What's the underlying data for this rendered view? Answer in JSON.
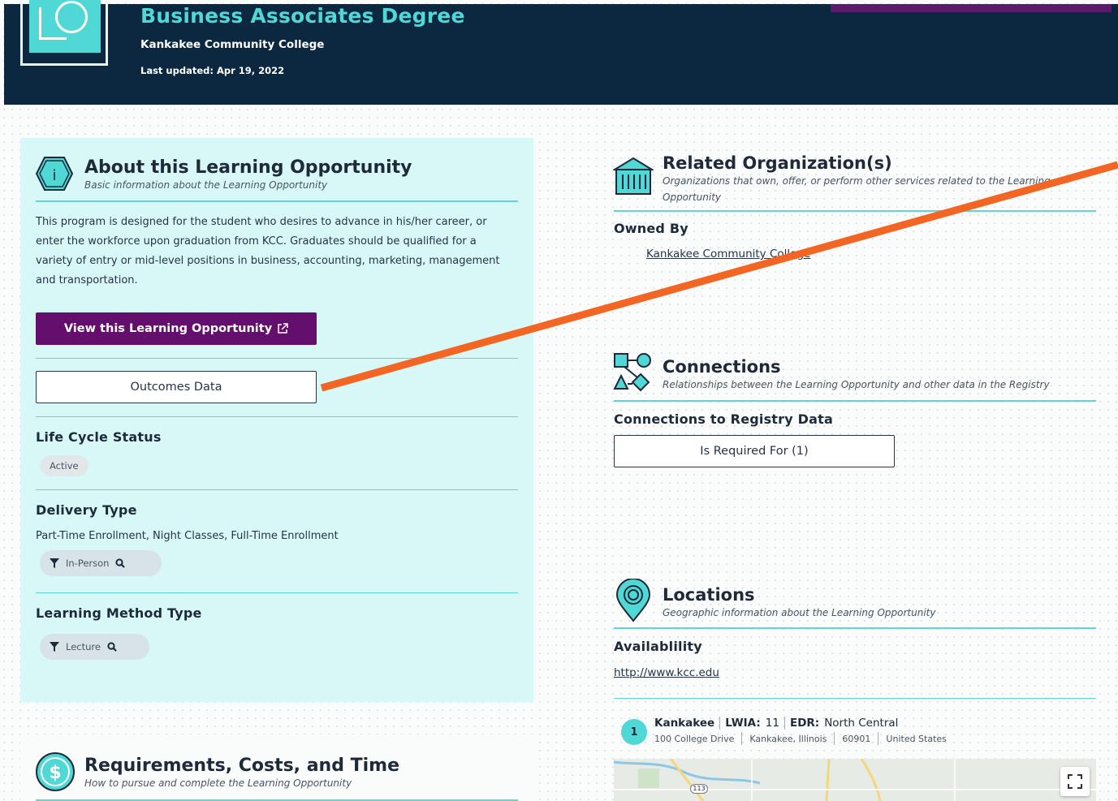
{
  "header": {
    "title": "Business Associates Degree",
    "organization": "Kankakee Community College",
    "last_updated": "Last updated: Apr 19, 2022"
  },
  "about": {
    "title": "About this Learning Opportunity",
    "subtitle": "Basic information about the Learning Opportunity",
    "description": "This program is designed for the student who desires to advance in his/her career, or enter the workforce upon graduation from KCC. Graduates should be qualified for a variety of entry or mid-level positions in business, accounting, marketing, management and transportation.",
    "view_button": "View this Learning Opportunity",
    "outcomes_button": "Outcomes Data",
    "life_cycle_label": "Life Cycle Status",
    "life_cycle_value": "Active",
    "delivery_label": "Delivery Type",
    "delivery_text": "Part-Time Enrollment, Night Classes, Full-Time Enrollment",
    "delivery_tag": "In-Person",
    "learning_method_label": "Learning Method Type",
    "learning_method_tag": "Lecture"
  },
  "requirements": {
    "title": "Requirements, Costs, and Time",
    "subtitle": "How to pursue and complete the Learning Opportunity"
  },
  "related_orgs": {
    "title": "Related Organization(s)",
    "subtitle": "Organizations that own, offer, or perform other services related to the Learning Opportunity",
    "owned_by_label": "Owned By",
    "owner": "Kankakee Community College"
  },
  "connections": {
    "title": "Connections",
    "subtitle": "Relationships between the Learning Opportunity and other data in the Registry",
    "label": "Connections to Registry Data",
    "button": "Is Required For (1)"
  },
  "locations": {
    "title": "Locations",
    "subtitle": "Geographic information about the Learning Opportunity",
    "availability_label": "Availablility",
    "availability_url": "http://www.kcc.edu",
    "items": [
      {
        "number": "1",
        "name": "Kankakee",
        "lwia_label": "LWIA:",
        "lwia_value": "11",
        "edr_label": "EDR:",
        "edr_value": "North Central",
        "street": "100 College Drive",
        "city": "Kankakee, Illinois",
        "zip": "60901",
        "country": "United States"
      }
    ],
    "map_road_label": "113"
  },
  "colors": {
    "header_bg": "#0c2740",
    "accent": "#4fd8d6",
    "primary_button": "#640f6e",
    "panel_bg": "#d8f7f7",
    "annotation": "#f26522"
  },
  "icons": [
    "info-hexagon-icon",
    "external-link-icon",
    "filter-icon",
    "search-icon",
    "building-icon",
    "connections-icon",
    "location-pin-icon",
    "dollar-icon",
    "expand-icon"
  ]
}
